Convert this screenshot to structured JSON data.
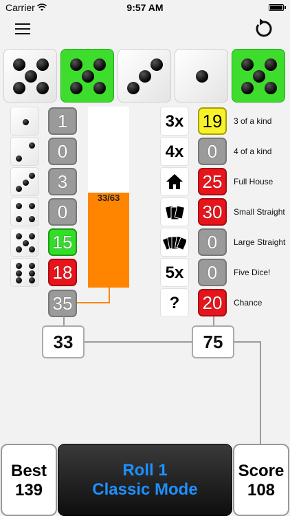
{
  "status_bar": {
    "carrier": "Carrier",
    "time": "9:57 AM"
  },
  "toolbar": {
    "menu_icon": "hamburger-menu-icon",
    "restart_icon": "restart-icon"
  },
  "dice": [
    {
      "value": 5,
      "held": false
    },
    {
      "value": 5,
      "held": true
    },
    {
      "value": 3,
      "held": false
    },
    {
      "value": 1,
      "held": false
    },
    {
      "value": 5,
      "held": true
    }
  ],
  "upper_section": [
    {
      "face": 1,
      "score": "1",
      "state": "gray"
    },
    {
      "face": 2,
      "score": "0",
      "state": "gray"
    },
    {
      "face": 3,
      "score": "3",
      "state": "gray"
    },
    {
      "face": 4,
      "score": "0",
      "state": "gray"
    },
    {
      "face": 5,
      "score": "15",
      "state": "green"
    },
    {
      "face": 6,
      "score": "18",
      "state": "red"
    }
  ],
  "upper_subtotal": "35",
  "bonus_progress": {
    "label": "33/63",
    "current": 33,
    "target": 63
  },
  "lower_section": [
    {
      "icon": "3x",
      "score": "19",
      "name": "3 of a kind",
      "state": "yellow"
    },
    {
      "icon": "4x",
      "score": "0",
      "name": "4 of a kind",
      "state": "gray"
    },
    {
      "icon": "house-icon",
      "score": "25",
      "name": "Full House",
      "state": "red"
    },
    {
      "icon": "cards-small-icon",
      "score": "30",
      "name": "Small Straight",
      "state": "red"
    },
    {
      "icon": "cards-large-icon",
      "score": "0",
      "name": "Large Straight",
      "state": "gray"
    },
    {
      "icon": "5x",
      "score": "0",
      "name": "Five Dice!",
      "state": "gray"
    },
    {
      "icon": "?",
      "score": "20",
      "name": "Chance",
      "state": "red"
    }
  ],
  "totals": {
    "upper": "33",
    "lower": "75"
  },
  "bottom": {
    "best_label": "Best",
    "best_value": "139",
    "roll_label": "Roll 1",
    "mode_label": "Classic Mode",
    "score_label": "Score",
    "score_value": "108"
  },
  "colors": {
    "held": "#3ddc2d",
    "green": "#33dd2a",
    "red": "#e8141c",
    "yellow": "#f7f22a",
    "gray": "#9a9a9a",
    "progress": "#ff8400",
    "roll_text": "#1e90ff"
  }
}
